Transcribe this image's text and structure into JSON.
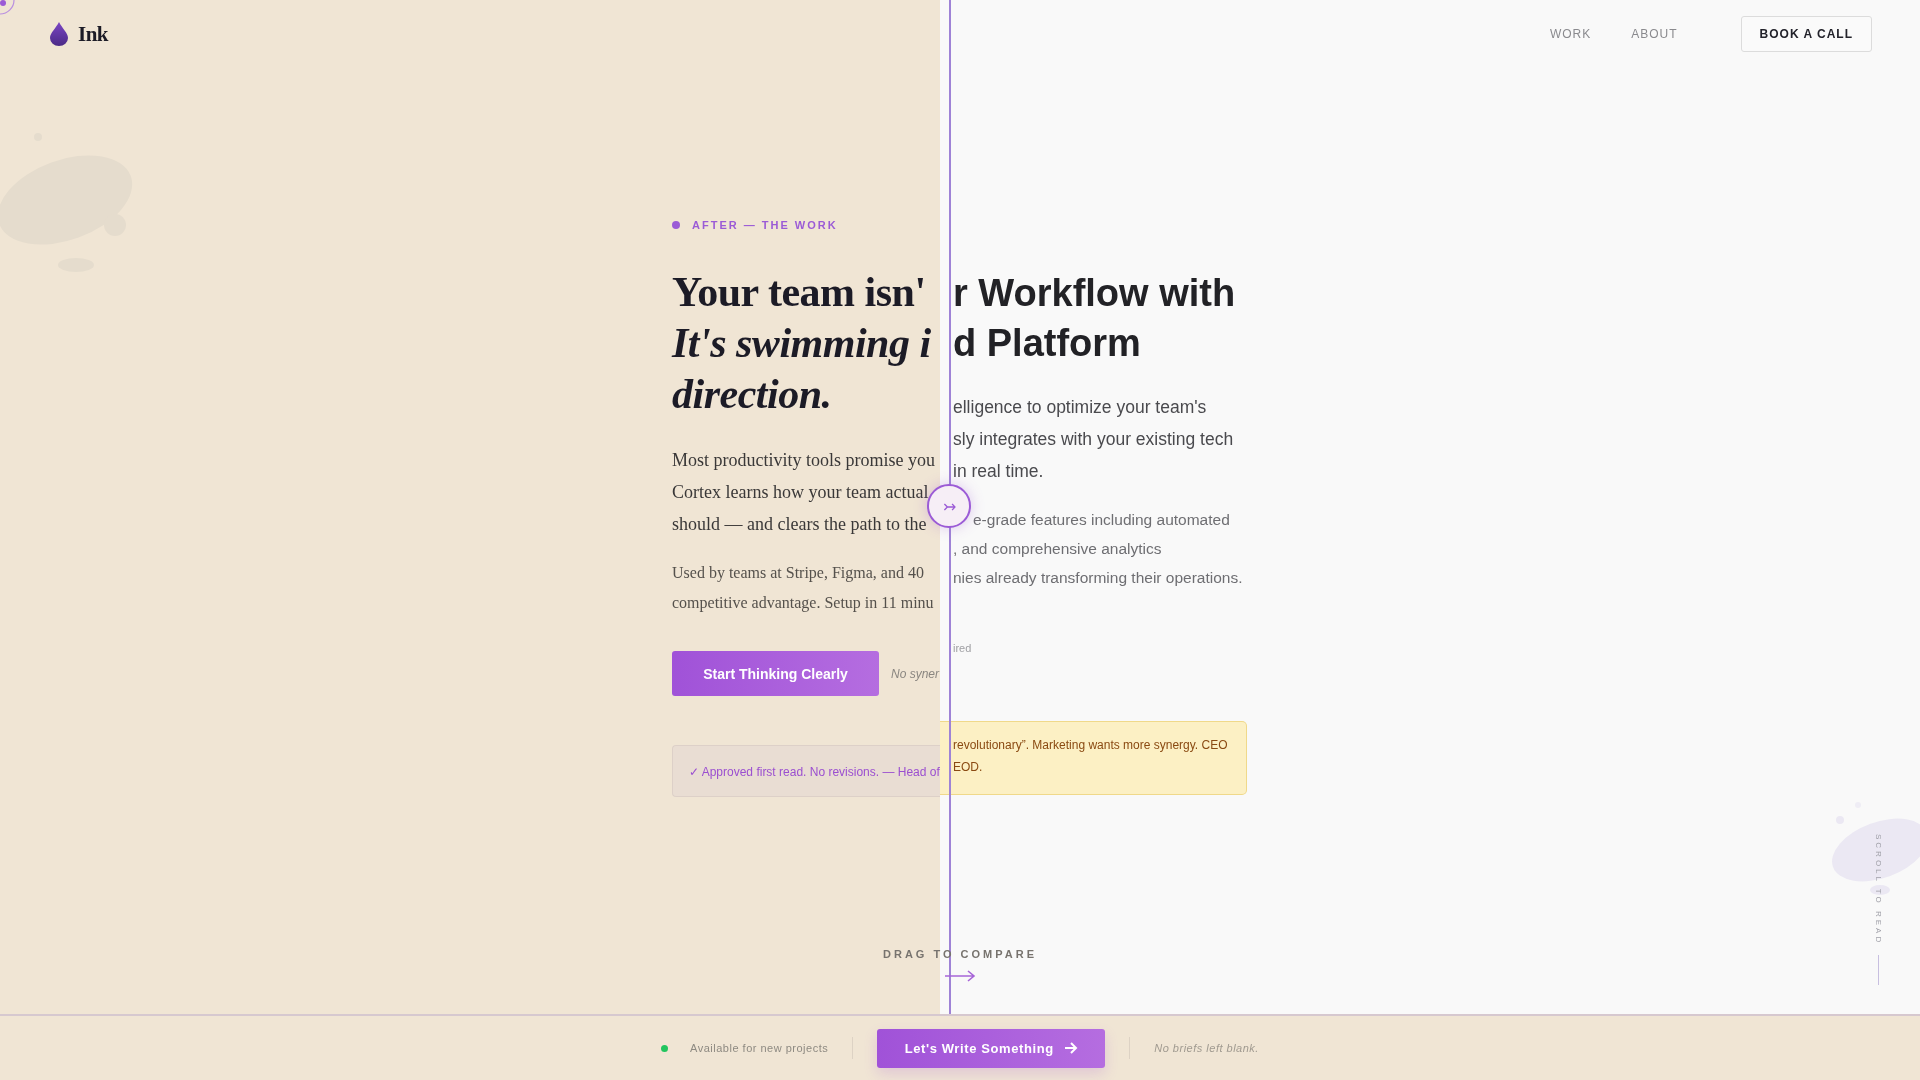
{
  "header": {
    "logo": "Ink",
    "nav": [
      {
        "label": "WORK"
      },
      {
        "label": "ABOUT"
      }
    ],
    "cta": "BOOK A CALL"
  },
  "after": {
    "tag": "AFTER — THE WORK",
    "headline": [
      {
        "text": "Your team isn'",
        "italic": false
      },
      {
        "text": "It's swimming i",
        "italic": true
      },
      {
        "text": "direction.",
        "italic": true
      }
    ],
    "body": [
      "Most productivity tools promise you",
      "Cortex learns how your team actual",
      "should — and clears the path to the"
    ],
    "used_by": [
      "Used by teams at Stripe, Figma, and 40",
      "competitive advantage. Setup in 11 minu"
    ],
    "cta": "Start Thinking Clearly",
    "cta_note": "No syner",
    "approval": "✓ Approved first read. No revisions. — Head of"
  },
  "before": {
    "headline": [
      "r Workflow with",
      "d Platform"
    ],
    "intro": [
      "elligence to optimize your team's",
      "sly integrates with your existing tech",
      "in real time."
    ],
    "details": [
      "e-grade features including automated",
      ", and comprehensive analytics",
      "nies already transforming their operations."
    ],
    "note": "ired",
    "memo": [
      "revolutionary”. Marketing wants more synergy. CEO",
      "EOD."
    ]
  },
  "compare": {
    "label": "DRAG TO COMPARE",
    "handle": "↣"
  },
  "scroll_hint": "SCROLL TO READ",
  "footer": {
    "status": "Available for new projects",
    "cta": "Let's Write Something",
    "tagline": "No briefs left blank."
  }
}
